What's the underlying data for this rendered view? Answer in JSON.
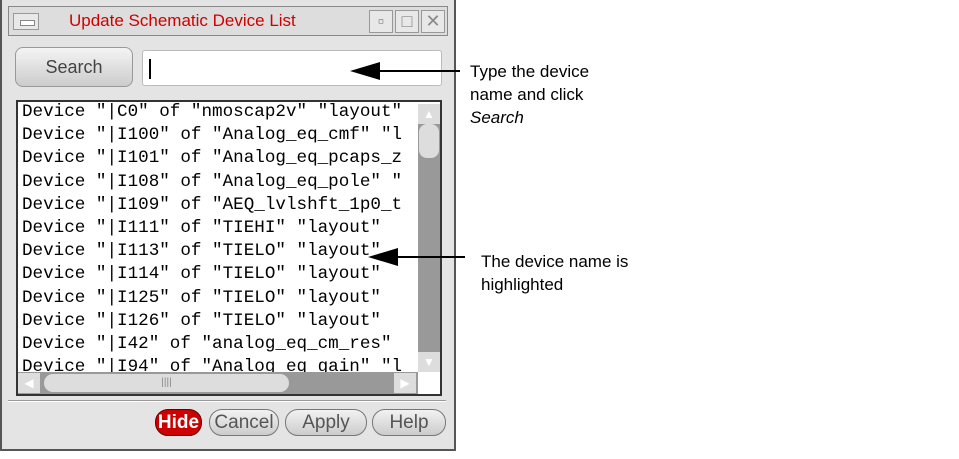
{
  "window": {
    "title": "Update Schematic Device List",
    "menu_icon": "window-menu-icon",
    "minimize_icon": "minimize-icon",
    "maximize_icon": "maximize-icon",
    "close_icon": "close-icon",
    "close_glyph": "✕"
  },
  "search": {
    "button_label": "Search",
    "value": ""
  },
  "list": {
    "rows": [
      "Device \"|C0\" of \"nmoscap2v\" \"layout\"",
      "Device \"|I100\" of \"Analog_eq_cmf\" \"l",
      "Device \"|I101\" of \"Analog_eq_pcaps_z",
      "Device \"|I108\" of \"Analog_eq_pole\" \"",
      "Device \"|I109\" of \"AEQ_lvlshft_1p0_t",
      "Device \"|I111\" of \"TIEHI\" \"layout\"",
      "Device \"|I113\" of \"TIELO\" \"layout\"",
      "Device \"|I114\" of \"TIELO\" \"layout\"",
      "Device \"|I125\" of \"TIELO\" \"layout\"",
      "Device \"|I126\" of \"TIELO\" \"layout\"",
      "Device \"|I42\" of \"analog_eq_cm_res\"",
      "Device \"|I94\" of \"Analog_eq_gain\" \"l"
    ],
    "hscroll_grip": "||||"
  },
  "buttons": {
    "hide": "Hide",
    "cancel": "Cancel",
    "apply": "Apply",
    "help": "Help"
  },
  "annotations": {
    "a1_line1": "Type the device",
    "a1_line2": "name and click",
    "a1_line3": "Search",
    "a2_line1": "The device name is",
    "a2_line2": "highlighted"
  },
  "colors": {
    "title": "#d10000",
    "hide": "#cc0000"
  }
}
